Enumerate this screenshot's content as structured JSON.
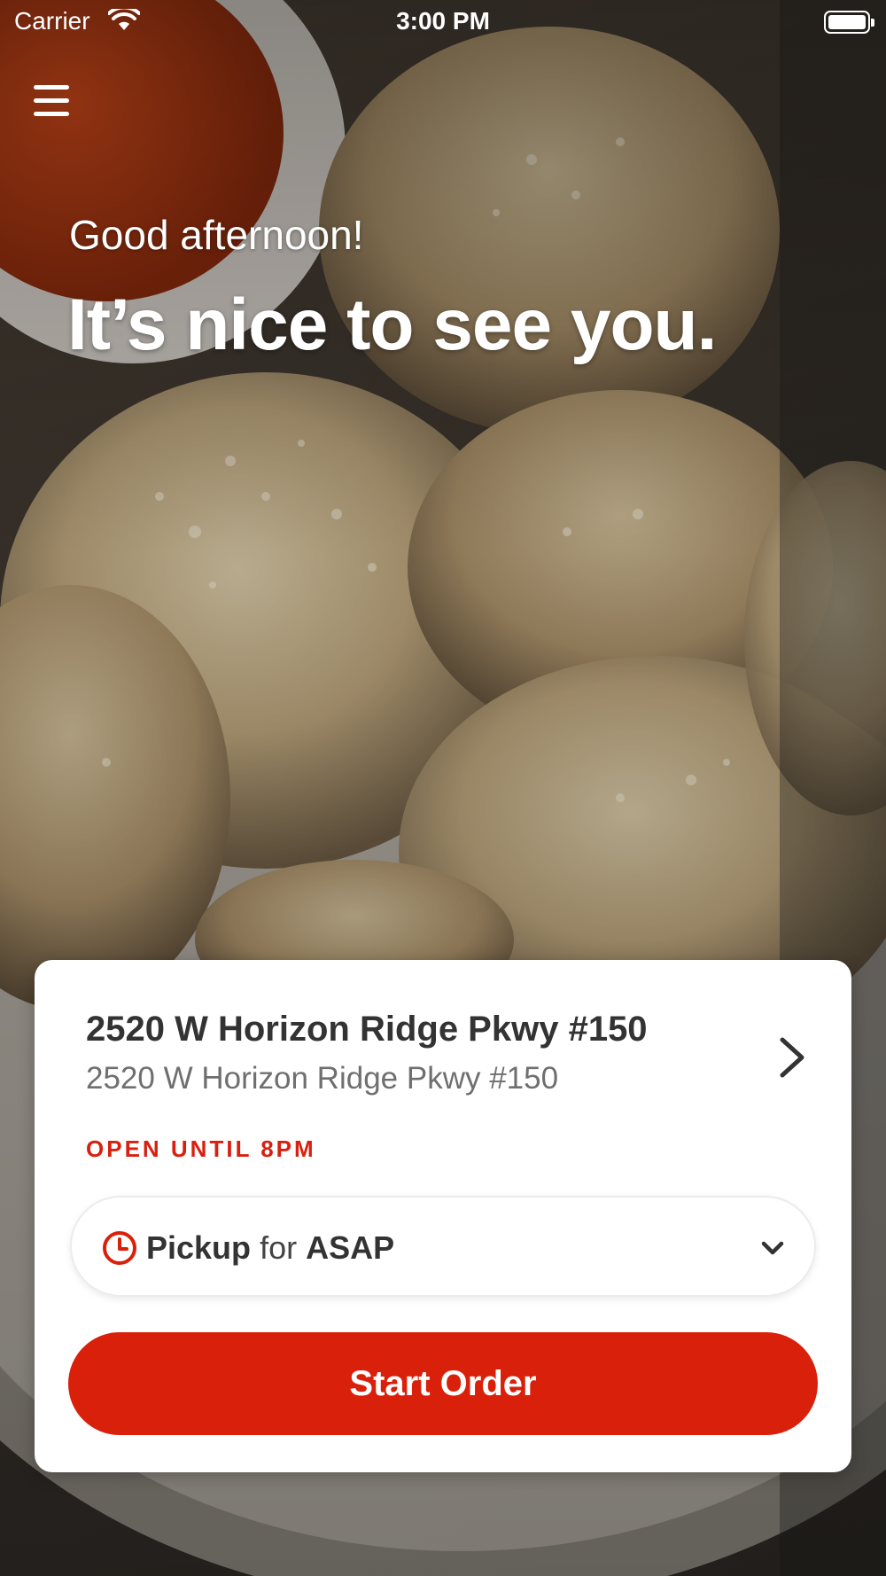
{
  "status_bar": {
    "carrier": "Carrier",
    "time": "3:00 PM"
  },
  "background": {
    "subject": "garlic knots with parmesan and marinara dip",
    "overlay_color": "#000000"
  },
  "greeting": {
    "line1": "Good afternoon!",
    "line2": "It’s nice to see you."
  },
  "location": {
    "name": "2520 W Horizon Ridge Pkwy #150",
    "address": "2520 W Horizon Ridge Pkwy #150",
    "hours": "OPEN UNTIL 8PM"
  },
  "order_mode": {
    "mode": "Pickup",
    "connector": "for",
    "time": "ASAP"
  },
  "actions": {
    "start_order": "Start Order"
  },
  "colors": {
    "accent": "#d9200a",
    "hours_text": "#d9200f",
    "card_bg": "#ffffff"
  },
  "icons": {
    "menu": "hamburger-icon",
    "store": "chevron-right-icon",
    "order_mode": "clock-icon",
    "dropdown": "chevron-down-icon"
  }
}
